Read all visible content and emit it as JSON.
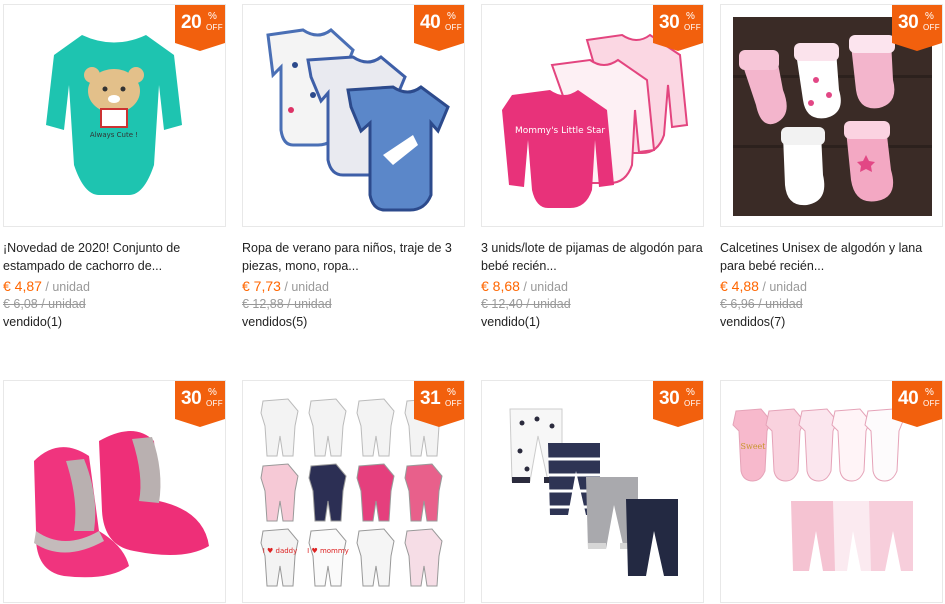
{
  "products": [
    {
      "discount": "20",
      "pct": "%",
      "off": "OFF",
      "title": "¡Novedad de 2020! Conjunto de estampado de cachorro de...",
      "price": "€ 4,87",
      "unit": " / unidad",
      "old_price": "€ 6,08 / unidad",
      "sold": "vendido(1)",
      "art_text": "Always Cute !"
    },
    {
      "discount": "40",
      "pct": "%",
      "off": "OFF",
      "title": "Ropa de verano para niños, traje de 3 piezas, mono, ropa...",
      "price": "€ 7,73",
      "unit": " / unidad",
      "old_price": "€ 12,88 / unidad",
      "sold": "vendidos(5)"
    },
    {
      "discount": "30",
      "pct": "%",
      "off": "OFF",
      "title": "3 unids/lote de pijamas de algodón para bebé recién...",
      "price": "€ 8,68",
      "unit": " / unidad",
      "old_price": "€ 12,40 / unidad",
      "sold": "vendido(1)",
      "art_text": "Mommy's Little Star"
    },
    {
      "discount": "30",
      "pct": "%",
      "off": "OFF",
      "title": "Calcetines Unisex de algodón y lana para bebé recién...",
      "price": "€ 4,88",
      "unit": " / unidad",
      "old_price": "€ 6,96 / unidad",
      "sold": "vendidos(7)"
    },
    {
      "discount": "30",
      "pct": "%",
      "off": "OFF"
    },
    {
      "discount": "31",
      "pct": "%",
      "off": "OFF",
      "art_text_1": "I ♥ daddy",
      "art_text_2": "I ♥ mommy"
    },
    {
      "discount": "30",
      "pct": "%",
      "off": "OFF"
    },
    {
      "discount": "40",
      "pct": "%",
      "off": "OFF",
      "art_text": "Sweet"
    }
  ],
  "colors": {
    "badge": "#f2600d",
    "price": "#ff6600",
    "muted": "#999999"
  }
}
